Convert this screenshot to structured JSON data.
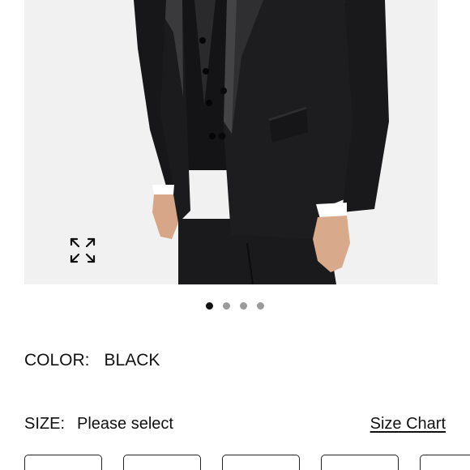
{
  "product": {
    "image_alt": "Black tuxedo with satin lapels and matching vest",
    "zoom_icon": "expand-arrows-icon"
  },
  "carousel": {
    "total_slides": 4,
    "active_index": 0
  },
  "color": {
    "label": "COLOR:",
    "value": "BLACK"
  },
  "size": {
    "label": "SIZE:",
    "value": "Please select",
    "chart_link": "Size Chart",
    "options_visible": 5
  },
  "colors": {
    "text": "#111111",
    "dot_inactive": "#9b9b9b",
    "dot_active": "#111111",
    "image_bg": "#f1f1f1"
  }
}
